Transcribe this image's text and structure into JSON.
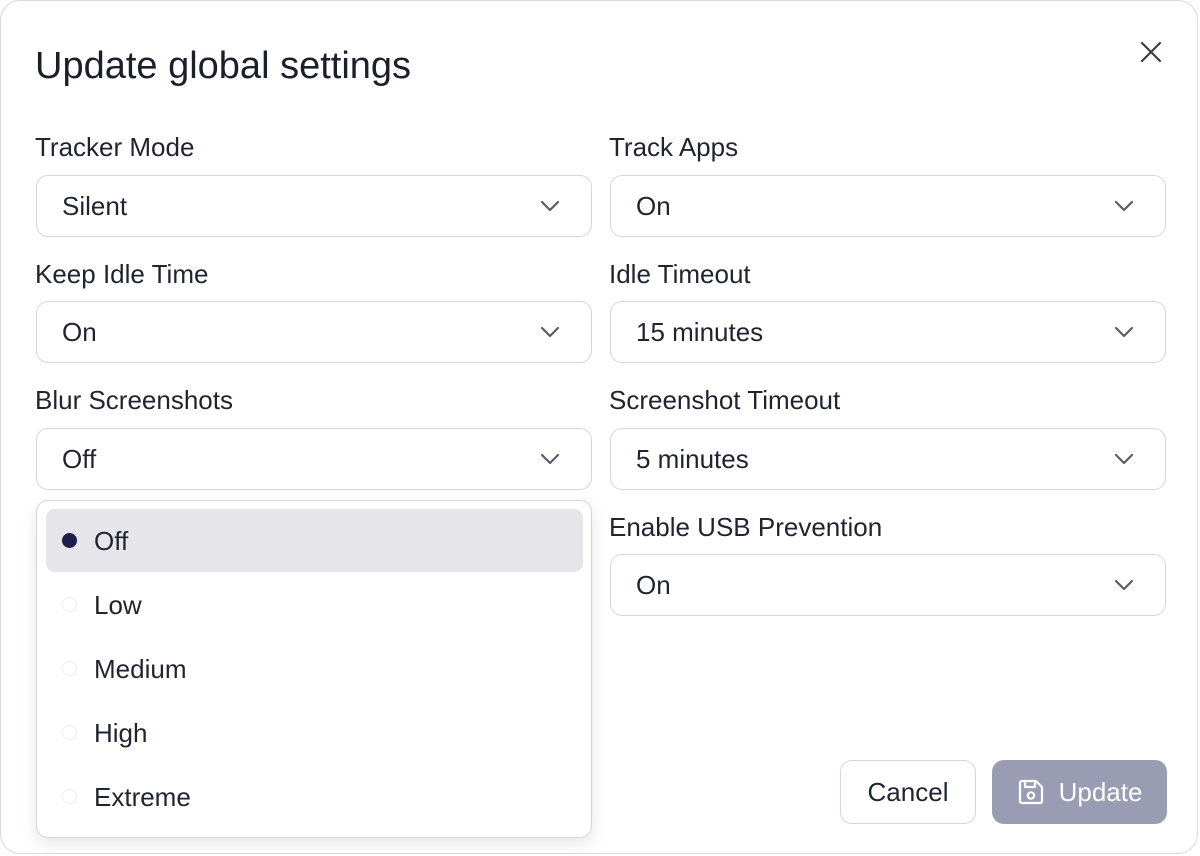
{
  "dialog": {
    "title": "Update global settings",
    "close_icon": "close-icon"
  },
  "fields": {
    "tracker_mode": {
      "label": "Tracker Mode",
      "value": "Silent"
    },
    "track_apps": {
      "label": "Track Apps",
      "value": "On"
    },
    "keep_idle_time": {
      "label": "Keep Idle Time",
      "value": "On"
    },
    "idle_timeout": {
      "label": "Idle Timeout",
      "value": "15 minutes"
    },
    "blur_screenshots": {
      "label": "Blur Screenshots",
      "value": "Off"
    },
    "screenshot_timeout": {
      "label": "Screenshot Timeout",
      "value": "5 minutes"
    },
    "enable_usb_prevention": {
      "label": "Enable USB Prevention",
      "value": "On"
    }
  },
  "blur_dropdown": {
    "options": [
      {
        "label": "Off",
        "selected": true
      },
      {
        "label": "Low",
        "selected": false
      },
      {
        "label": "Medium",
        "selected": false
      },
      {
        "label": "High",
        "selected": false
      },
      {
        "label": "Extreme",
        "selected": false
      }
    ]
  },
  "actions": {
    "cancel_label": "Cancel",
    "update_label": "Update",
    "update_icon": "save-icon"
  },
  "colors": {
    "selected_option_bg": "#e5e5ea",
    "radio_selected": "#1c1f4a",
    "update_button_bg": "#9a9cb4",
    "border": "#d6d6de"
  }
}
